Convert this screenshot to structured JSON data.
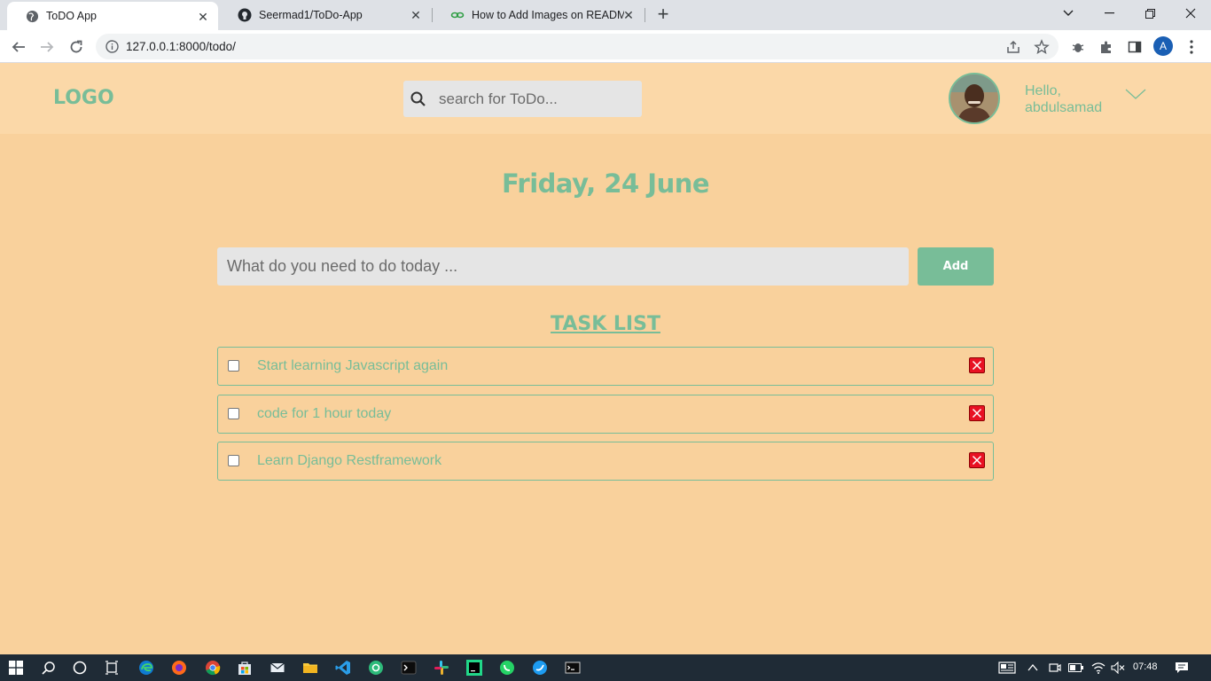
{
  "browser": {
    "tabs": [
      {
        "label": "ToDO App",
        "active": true,
        "icon": "globe-icon"
      },
      {
        "label": "Seermad1/ToDo-App",
        "active": false,
        "icon": "github-icon"
      },
      {
        "label": "How to Add Images on README",
        "active": false,
        "icon": "link-icon"
      }
    ],
    "url": "127.0.0.1:8000/todo/",
    "profile_initial": "A"
  },
  "header": {
    "logo": "LOGO",
    "search_placeholder": "search for ToDo...",
    "greeting_line1": "Hello,",
    "greeting_line2": "abdulsamad"
  },
  "main": {
    "date": "Friday, 24 June",
    "task_input_placeholder": "What do you need to do today ...",
    "add_label": "Add",
    "list_title": "TASK LIST",
    "tasks": [
      {
        "label": "Start learning Javascript again",
        "done": false
      },
      {
        "label": "code for 1 hour today",
        "done": false
      },
      {
        "label": "Learn Django Restframework",
        "done": false
      }
    ]
  },
  "taskbar": {
    "time": "07:48"
  },
  "colors": {
    "page_bg": "#f9d19c",
    "header_bg": "#fbd8a8",
    "accent": "#78bd98",
    "delete": "#e81123"
  }
}
